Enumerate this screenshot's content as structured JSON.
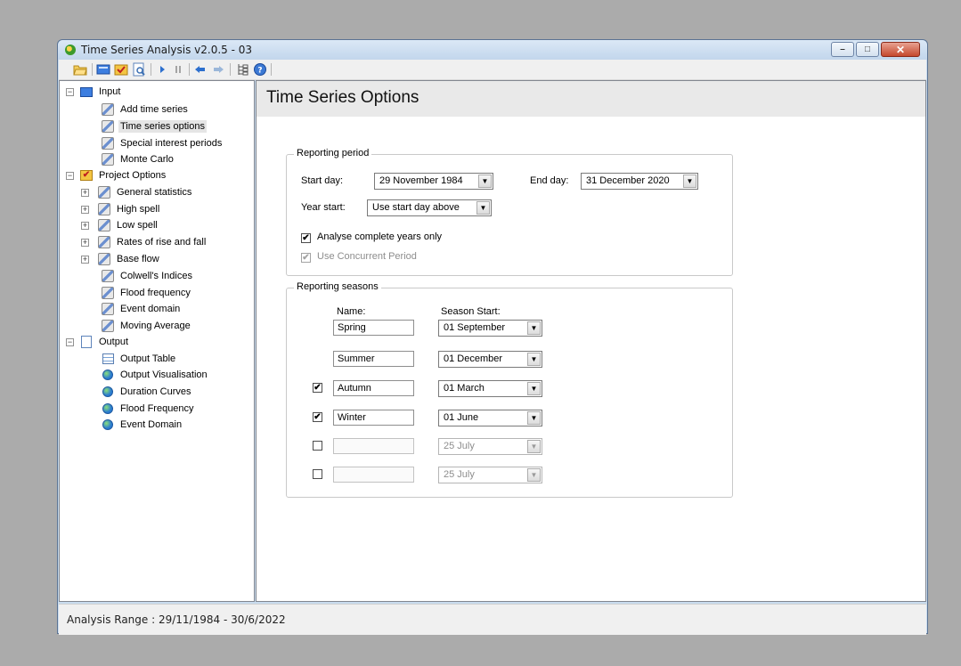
{
  "window": {
    "title": "Time Series Analysis v2.0.5 - 03",
    "caption": {
      "minimize": "–",
      "maximize": "□",
      "close": "✕"
    }
  },
  "toolbar": {
    "icons": [
      "open-folder-icon",
      "monitor-icon",
      "checklist-icon",
      "document-icon",
      "play-icon",
      "pause-icon",
      "back-icon",
      "forward-icon",
      "tree-icon",
      "help-icon"
    ]
  },
  "tree": {
    "input": "Input",
    "add_time_series": "Add time series",
    "time_series_options": "Time series options",
    "special_interest_periods": "Special interest periods",
    "monte_carlo": "Monte Carlo",
    "project_options": "Project Options",
    "general_statistics": "General statistics",
    "high_spell": "High spell",
    "low_spell": "Low spell",
    "rates_of_rise_and_fall": "Rates of rise and fall",
    "base_flow": "Base flow",
    "colwells_indices": "Colwell's Indices",
    "flood_frequency": "Flood frequency",
    "event_domain": "Event domain",
    "moving_average": "Moving Average",
    "output": "Output",
    "output_table": "Output Table",
    "output_visualisation": "Output Visualisation",
    "duration_curves": "Duration Curves",
    "flood_frequency_out": "Flood Frequency",
    "event_domain_out": "Event Domain",
    "expand_symbol": "+",
    "collapse_symbol": "−"
  },
  "main": {
    "title": "Time Series Options",
    "reporting_period": {
      "legend": "Reporting period",
      "start_day_label": "Start day:",
      "start_day_value": "29 November 1984",
      "end_day_label": "End day:",
      "end_day_value": "31 December 2020",
      "year_start_label": "Year start:",
      "year_start_value": "Use start day above",
      "analyse_complete_years": "Analyse complete years only",
      "analyse_complete_years_checked": true,
      "use_concurrent_period": "Use Concurrent Period",
      "use_concurrent_period_checked": true
    },
    "reporting_seasons": {
      "legend": "Reporting seasons",
      "name_header": "Name:",
      "season_start_header": "Season Start:",
      "rows": [
        {
          "checked": null,
          "name": "Spring",
          "start": "01 September",
          "enabled": true
        },
        {
          "checked": null,
          "name": "Summer",
          "start": "01 December",
          "enabled": true
        },
        {
          "checked": true,
          "name": "Autumn",
          "start": "01   March",
          "enabled": true
        },
        {
          "checked": true,
          "name": "Winter",
          "start": "01   June",
          "enabled": true
        },
        {
          "checked": false,
          "name": "",
          "start": "25   July",
          "enabled": false
        },
        {
          "checked": false,
          "name": "",
          "start": "25   July",
          "enabled": false
        }
      ]
    }
  },
  "status": {
    "text": "Analysis Range : 29/11/1984 - 30/6/2022"
  },
  "glyphs": {
    "check": "✔",
    "dropdown": "▼"
  }
}
